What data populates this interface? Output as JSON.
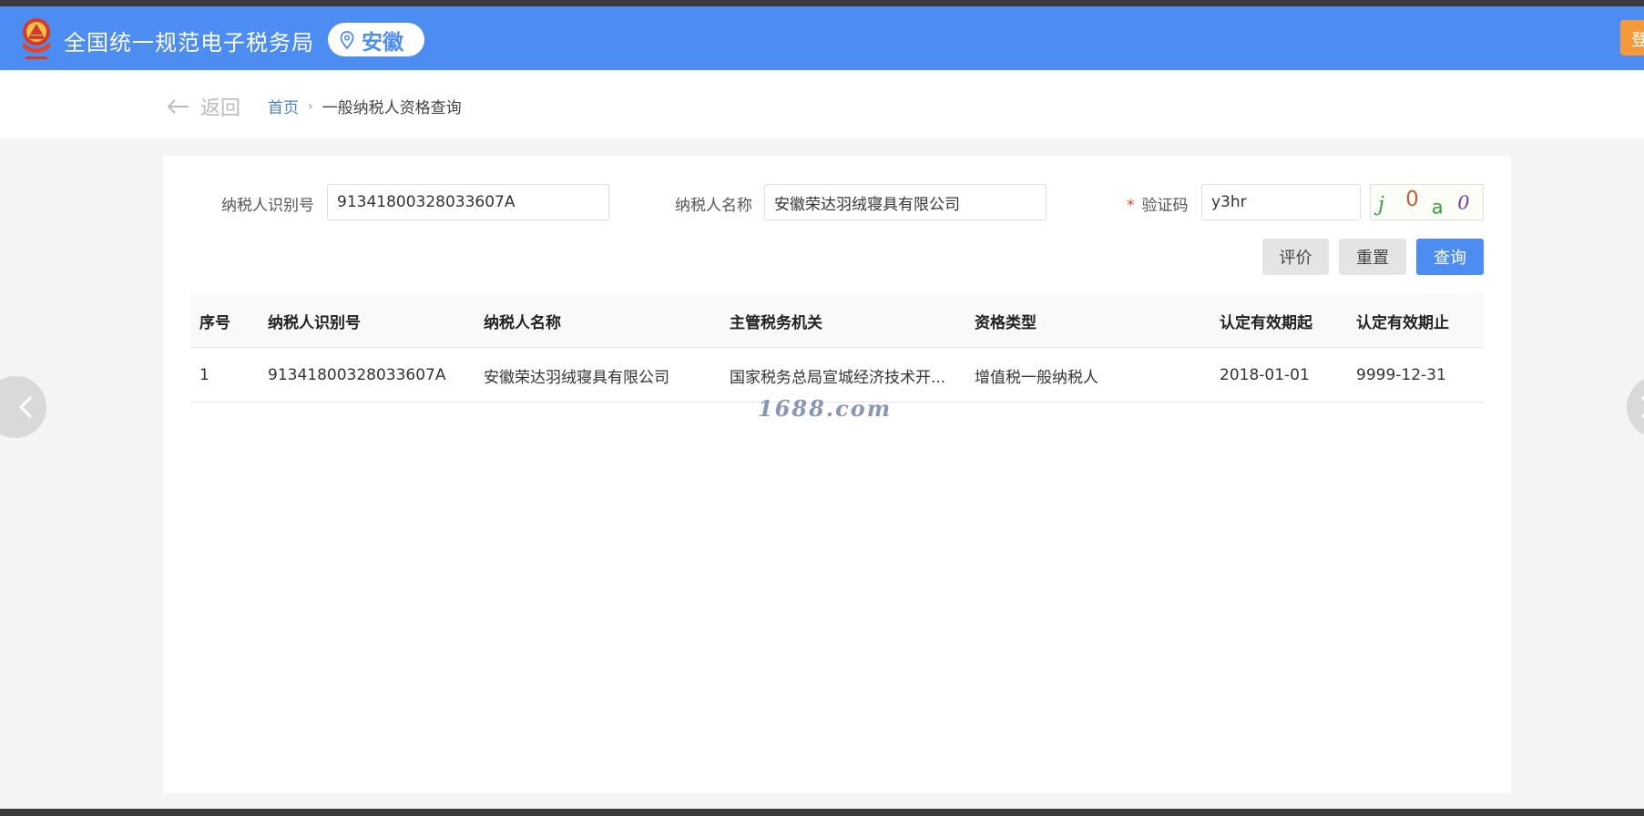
{
  "header": {
    "site_title": "全国统一规范电子税务局",
    "region": "安徽",
    "login_label": "登",
    "emblem_icon": "tax-emblem-icon",
    "brand_color": "#4d8cf0"
  },
  "breadcrumb": {
    "back_label": "返回",
    "home_label": "首页",
    "current_label": "一般纳税人资格查询"
  },
  "form": {
    "taxpayer_id_label": "纳税人识别号",
    "taxpayer_id_value": "91341800328033607A",
    "taxpayer_name_label": "纳税人名称",
    "taxpayer_name_value": "安徽荣达羽绒寝具有限公司",
    "captcha_required_mark": "*",
    "captcha_label": "验证码",
    "captcha_value": "y3hr",
    "captcha_image_text": "j0a0"
  },
  "buttons": {
    "evaluate": "评价",
    "reset": "重置",
    "query": "查询"
  },
  "table": {
    "headers": [
      "序号",
      "纳税人识别号",
      "纳税人名称",
      "主管税务机关",
      "资格类型",
      "认定有效期起",
      "认定有效期止"
    ],
    "rows": [
      [
        "1",
        "91341800328033607A",
        "安徽荣达羽绒寝具有限公司",
        "国家税务总局宣城经济技术开...",
        "增值税一般纳税人",
        "2018-01-01",
        "9999-12-31"
      ]
    ]
  },
  "watermark": "1688.com",
  "nav": {
    "prev_icon": "chevron-left-icon",
    "next_icon": "chevron-right-icon"
  }
}
